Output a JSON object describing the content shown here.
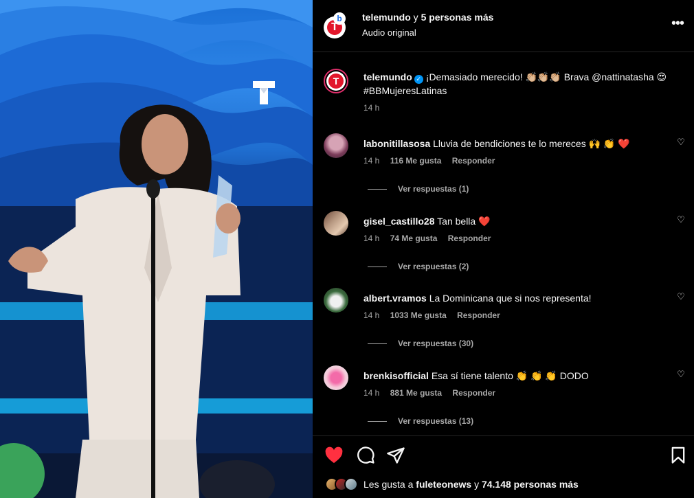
{
  "header": {
    "account": "telemundo",
    "connector": "y",
    "others": "5 personas más",
    "audio": "Audio original",
    "more_icon": "more-horizontal-icon"
  },
  "caption": {
    "username": "telemundo",
    "text": "¡Demasiado merecido! 👏🏼👏🏼👏🏼 Brava @nattinatasha 😍 #BBMujeresLatinas",
    "time": "14 h"
  },
  "comments": [
    {
      "username": "labonitillasosa",
      "text": "Lluvia de bendiciones te lo mereces 🙌 👏 ❤️",
      "time": "14 h",
      "likes": "116 Me gusta",
      "reply": "Responder",
      "view_replies": "Ver respuestas (1)"
    },
    {
      "username": "gisel_castillo28",
      "text": "Tan bella ❤️",
      "time": "14 h",
      "likes": "74 Me gusta",
      "reply": "Responder",
      "view_replies": "Ver respuestas (2)"
    },
    {
      "username": "albert.vramos",
      "text": "La Dominicana que si nos representa!",
      "time": "14 h",
      "likes": "1033 Me gusta",
      "reply": "Responder",
      "view_replies": "Ver respuestas (30)"
    },
    {
      "username": "brenkisofficial",
      "text": "Esa sí tiene talento 👏 👏 👏 DODO",
      "time": "14 h",
      "likes": "881 Me gusta",
      "reply": "Responder",
      "view_replies": "Ver respuestas (13)"
    }
  ],
  "footer": {
    "likes_prefix": "Les gusta a",
    "likes_user": "fuleteonews",
    "likes_connector": "y",
    "likes_count": "74.148 personas más"
  },
  "colors": {
    "like_red": "#ff3040",
    "brand_red": "#e2162b",
    "verified_blue": "#0095f6"
  }
}
